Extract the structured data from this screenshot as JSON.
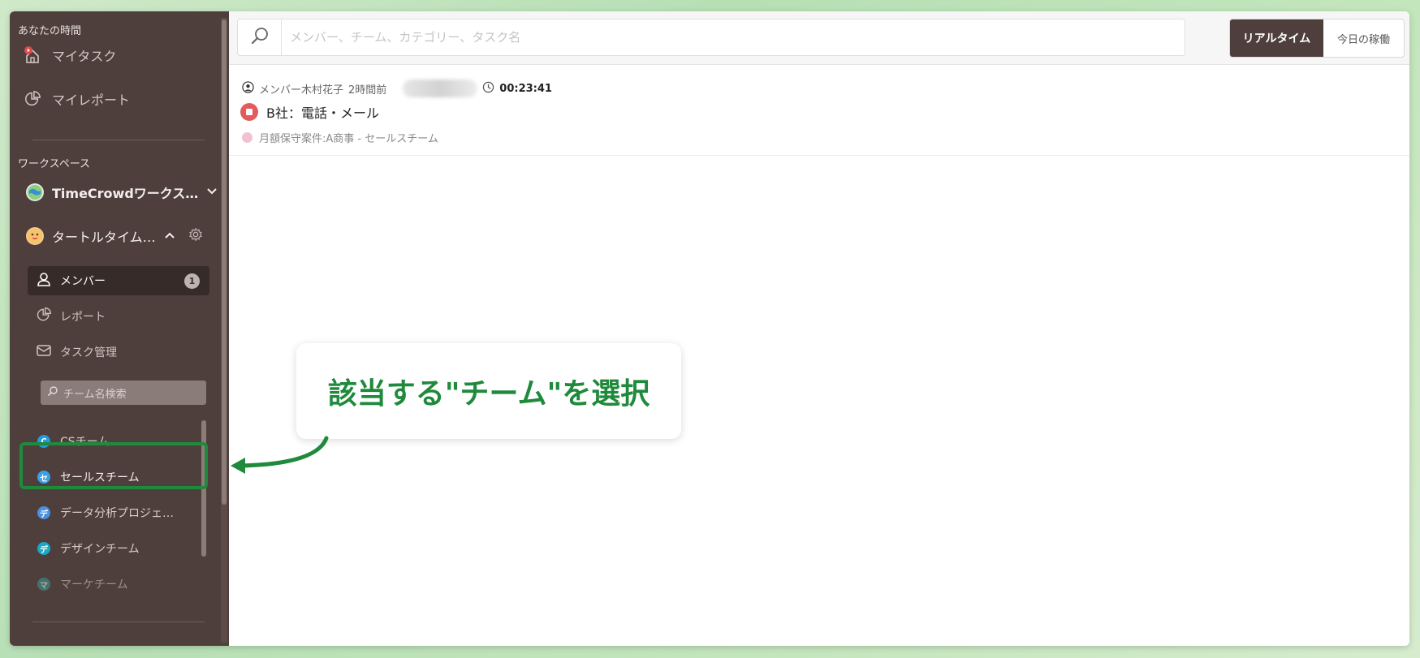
{
  "sidebar": {
    "your_time_label": "あなたの時間",
    "my_task": "マイタスク",
    "my_report": "マイレポート",
    "workspace_label": "ワークスペース",
    "workspaces": [
      {
        "name": "TimeCrowdワークス…",
        "expanded": false
      },
      {
        "name": "タートルタイム…",
        "expanded": true
      }
    ],
    "sub_items": [
      {
        "label": "メンバー",
        "badge": "1",
        "active": true
      },
      {
        "label": "レポート"
      },
      {
        "label": "タスク管理"
      }
    ],
    "team_search_placeholder": "チーム名検索",
    "teams": [
      {
        "label": "CSチーム",
        "initial": "C",
        "color": "#1f9be0"
      },
      {
        "label": "セールスチーム",
        "initial": "セ",
        "color": "#3aa0e8"
      },
      {
        "label": "データ分析プロジェ…",
        "initial": "デ",
        "color": "#4a90e2"
      },
      {
        "label": "デザインチーム",
        "initial": "デ",
        "color": "#17a9c7"
      },
      {
        "label": "マーケチーム",
        "initial": "マ",
        "color": "#3b9c95"
      }
    ]
  },
  "topbar": {
    "search_placeholder": "メンバー、チーム、カテゴリー、タスク名",
    "toggle_realtime": "リアルタイム",
    "toggle_today": "今日の稼働"
  },
  "entry": {
    "member": "メンバー木村花子",
    "ago": "2時間前",
    "duration": "00:23:41",
    "title": "B社：電話・メール",
    "category": "月額保守案件:A商事 - セールスチーム"
  },
  "callout": {
    "text": "該当する\"チーム\"を選択"
  },
  "colors": {
    "sidebar_bg": "#4f3f3c",
    "accent_green": "#1f8a3c",
    "stop_red": "#e35b5b"
  }
}
